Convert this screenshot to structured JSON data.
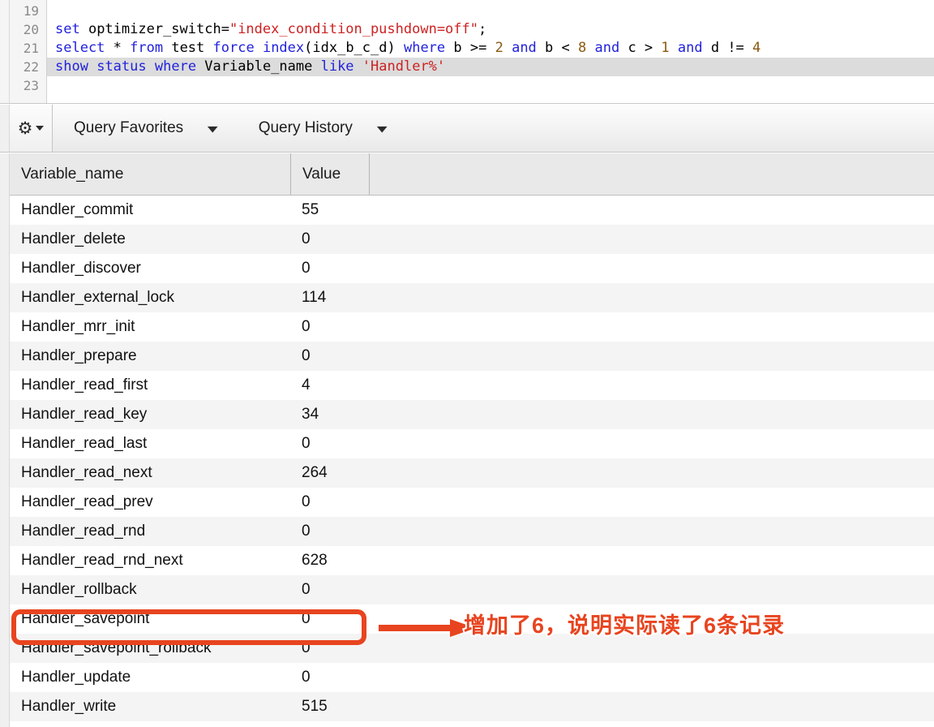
{
  "editor": {
    "line_numbers": [
      "19",
      "20",
      "21",
      "22",
      "23"
    ],
    "lines": [
      {
        "number": "19",
        "active": false,
        "tokens": []
      },
      {
        "number": "20",
        "active": false,
        "tokens": [
          {
            "t": "set",
            "c": "kw"
          },
          {
            "t": " optimizer_switch=",
            "c": "plain"
          },
          {
            "t": "\"index_condition_pushdown=off\"",
            "c": "str"
          },
          {
            "t": ";",
            "c": "plain"
          }
        ]
      },
      {
        "number": "21",
        "active": false,
        "tokens": [
          {
            "t": "select",
            "c": "kw"
          },
          {
            "t": " * ",
            "c": "plain"
          },
          {
            "t": "from",
            "c": "kw"
          },
          {
            "t": " test ",
            "c": "plain"
          },
          {
            "t": "force",
            "c": "kw"
          },
          {
            "t": " ",
            "c": "plain"
          },
          {
            "t": "index",
            "c": "kw"
          },
          {
            "t": "(idx_b_c_d) ",
            "c": "plain"
          },
          {
            "t": "where",
            "c": "kw"
          },
          {
            "t": " b >= ",
            "c": "plain"
          },
          {
            "t": "2",
            "c": "num"
          },
          {
            "t": " ",
            "c": "plain"
          },
          {
            "t": "and",
            "c": "kw"
          },
          {
            "t": " b < ",
            "c": "plain"
          },
          {
            "t": "8",
            "c": "num"
          },
          {
            "t": " ",
            "c": "plain"
          },
          {
            "t": "and",
            "c": "kw"
          },
          {
            "t": " c > ",
            "c": "plain"
          },
          {
            "t": "1",
            "c": "num"
          },
          {
            "t": " ",
            "c": "plain"
          },
          {
            "t": "and",
            "c": "kw"
          },
          {
            "t": " d != ",
            "c": "plain"
          },
          {
            "t": "4",
            "c": "num"
          }
        ]
      },
      {
        "number": "22",
        "active": true,
        "tokens": [
          {
            "t": "show",
            "c": "kw"
          },
          {
            "t": " ",
            "c": "plain"
          },
          {
            "t": "status",
            "c": "kw"
          },
          {
            "t": " ",
            "c": "plain"
          },
          {
            "t": "where",
            "c": "kw"
          },
          {
            "t": " Variable_name ",
            "c": "plain"
          },
          {
            "t": "like",
            "c": "kw"
          },
          {
            "t": " ",
            "c": "plain"
          },
          {
            "t": "'Handler%'",
            "c": "str"
          }
        ]
      },
      {
        "number": "23",
        "active": false,
        "tokens": []
      }
    ]
  },
  "toolbar": {
    "gear_icon": "gear-icon",
    "gear_caret_icon": "caret-down-icon",
    "query_favorites_label": "Query Favorites",
    "query_favorites_chevron": "⌄",
    "query_history_label": "Query History",
    "query_history_chevron": "⌄"
  },
  "grid": {
    "columns": [
      "Variable_name",
      "Value",
      ""
    ],
    "rows": [
      {
        "name": "Handler_commit",
        "value": "55"
      },
      {
        "name": "Handler_delete",
        "value": "0"
      },
      {
        "name": "Handler_discover",
        "value": "0"
      },
      {
        "name": "Handler_external_lock",
        "value": "114"
      },
      {
        "name": "Handler_mrr_init",
        "value": "0"
      },
      {
        "name": "Handler_prepare",
        "value": "0"
      },
      {
        "name": "Handler_read_first",
        "value": "4"
      },
      {
        "name": "Handler_read_key",
        "value": "34"
      },
      {
        "name": "Handler_read_last",
        "value": "0"
      },
      {
        "name": "Handler_read_next",
        "value": "264"
      },
      {
        "name": "Handler_read_prev",
        "value": "0"
      },
      {
        "name": "Handler_read_rnd",
        "value": "0"
      },
      {
        "name": "Handler_read_rnd_next",
        "value": "628"
      },
      {
        "name": "Handler_rollback",
        "value": "0"
      },
      {
        "name": "Handler_savepoint",
        "value": "0"
      },
      {
        "name": "Handler_savepoint_rollback",
        "value": "0"
      },
      {
        "name": "Handler_update",
        "value": "0"
      },
      {
        "name": "Handler_write",
        "value": "515"
      }
    ]
  },
  "annotation": {
    "text": "增加了6，说明实际读了6条记录",
    "color": "#e8441f",
    "outline_color": "#ffffff",
    "highlight_row_name": "Handler_read_next",
    "highlight_row_value": "264",
    "arrow_icon": "arrow-right-icon"
  }
}
